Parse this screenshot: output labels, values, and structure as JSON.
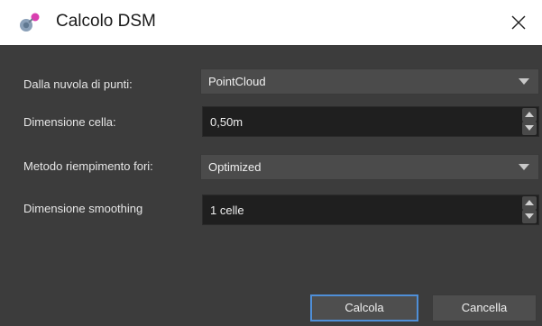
{
  "window": {
    "title": "Calcolo DSM",
    "app_icon": "molecule-icon",
    "close_icon": "close-icon"
  },
  "form": {
    "point_cloud": {
      "label": "Dalla nuvola di punti:",
      "value": "PointCloud"
    },
    "cell_size": {
      "label": "Dimensione cella:",
      "value": "0,50m"
    },
    "hole_fill": {
      "label": "Metodo riempimento fori:",
      "value": "Optimized"
    },
    "smoothing": {
      "label": "Dimensione smoothing",
      "value": "1 celle"
    }
  },
  "buttons": {
    "ok_label": "Calcola",
    "cancel_label": "Cancella"
  },
  "colors": {
    "background": "#3c3c3c",
    "accent": "#4f8fd8"
  }
}
